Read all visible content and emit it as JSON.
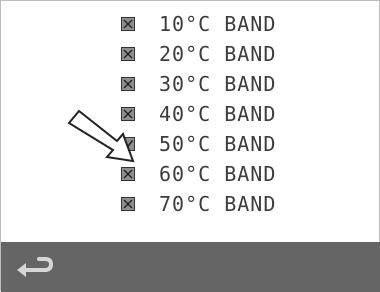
{
  "bands": [
    {
      "label": "10°C BAND",
      "state": "excluded"
    },
    {
      "label": "20°C BAND",
      "state": "excluded"
    },
    {
      "label": "30°C BAND",
      "state": "excluded"
    },
    {
      "label": "40°C BAND",
      "state": "excluded"
    },
    {
      "label": "50°C BAND",
      "state": "checked"
    },
    {
      "label": "60°C BAND",
      "state": "excluded"
    },
    {
      "label": "70°C BAND",
      "state": "excluded"
    }
  ],
  "icons": {
    "pointer": "arrow-pointer-icon",
    "back": "return-arrow-icon"
  },
  "colors": {
    "bottom_bar": "#656565",
    "checkbox_fill": "#8f8f8f",
    "text": "#3c3c3c",
    "back_icon": "#d6d6d6"
  }
}
